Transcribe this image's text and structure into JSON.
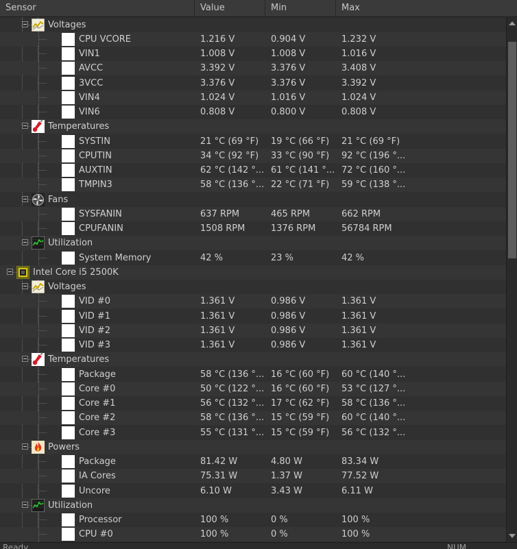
{
  "header": {
    "sensor": "Sensor",
    "value": "Value",
    "min": "Min",
    "max": "Max"
  },
  "rows": [
    {
      "level": 2,
      "kind": "group",
      "icon": "voltage-icon",
      "name": "Voltages"
    },
    {
      "level": 3,
      "kind": "sensor",
      "name": "CPU VCORE",
      "value": "1.216 V",
      "min": "0.904 V",
      "max": "1.232 V"
    },
    {
      "level": 3,
      "kind": "sensor",
      "name": "VIN1",
      "value": "1.008 V",
      "min": "1.008 V",
      "max": "1.016 V"
    },
    {
      "level": 3,
      "kind": "sensor",
      "name": "AVCC",
      "value": "3.392 V",
      "min": "3.376 V",
      "max": "3.408 V"
    },
    {
      "level": 3,
      "kind": "sensor",
      "name": "3VCC",
      "value": "3.376 V",
      "min": "3.376 V",
      "max": "3.392 V"
    },
    {
      "level": 3,
      "kind": "sensor",
      "name": "VIN4",
      "value": "1.024 V",
      "min": "1.016 V",
      "max": "1.024 V"
    },
    {
      "level": 3,
      "kind": "sensor",
      "name": "VIN6",
      "value": "0.808 V",
      "min": "0.800 V",
      "max": "0.808 V"
    },
    {
      "level": 2,
      "kind": "group",
      "icon": "thermometer-icon",
      "name": "Temperatures"
    },
    {
      "level": 3,
      "kind": "sensor",
      "name": "SYSTIN",
      "value": "21 °C  (69 °F)",
      "min": "19 °C  (66 °F)",
      "max": "21 °C  (69 °F)"
    },
    {
      "level": 3,
      "kind": "sensor",
      "name": "CPUTIN",
      "value": "34 °C  (92 °F)",
      "min": "33 °C  (90 °F)",
      "max": "92 °C  (196 °..."
    },
    {
      "level": 3,
      "kind": "sensor",
      "name": "AUXTIN",
      "value": "62 °C  (142 °...",
      "min": "61 °C  (141 °...",
      "max": "72 °C  (160 °..."
    },
    {
      "level": 3,
      "kind": "sensor",
      "name": "TMPIN3",
      "value": "58 °C  (136 °...",
      "min": "22 °C  (71 °F)",
      "max": "59 °C  (138 °..."
    },
    {
      "level": 2,
      "kind": "group",
      "icon": "fan-icon",
      "name": "Fans"
    },
    {
      "level": 3,
      "kind": "sensor",
      "name": "SYSFANIN",
      "value": "637 RPM",
      "min": "465 RPM",
      "max": "662 RPM"
    },
    {
      "level": 3,
      "kind": "sensor",
      "name": "CPUFANIN",
      "value": "1508 RPM",
      "min": "1376 RPM",
      "max": "56784 RPM"
    },
    {
      "level": 2,
      "kind": "group",
      "icon": "utilization-icon",
      "name": "Utilization"
    },
    {
      "level": 3,
      "kind": "sensor",
      "name": "System Memory",
      "value": "42 %",
      "min": "23 %",
      "max": "42 %"
    },
    {
      "level": 1,
      "kind": "hardware",
      "icon": "cpu-chip-icon",
      "name": "Intel Core i5 2500K"
    },
    {
      "level": 2,
      "kind": "group",
      "icon": "voltage-icon",
      "name": "Voltages"
    },
    {
      "level": 3,
      "kind": "sensor",
      "name": "VID #0",
      "value": "1.361 V",
      "min": "0.986 V",
      "max": "1.361 V"
    },
    {
      "level": 3,
      "kind": "sensor",
      "name": "VID #1",
      "value": "1.361 V",
      "min": "0.986 V",
      "max": "1.361 V"
    },
    {
      "level": 3,
      "kind": "sensor",
      "name": "VID #2",
      "value": "1.361 V",
      "min": "0.986 V",
      "max": "1.361 V"
    },
    {
      "level": 3,
      "kind": "sensor",
      "name": "VID #3",
      "value": "1.361 V",
      "min": "0.986 V",
      "max": "1.361 V"
    },
    {
      "level": 2,
      "kind": "group",
      "icon": "thermometer-icon",
      "name": "Temperatures"
    },
    {
      "level": 3,
      "kind": "sensor",
      "name": "Package",
      "value": "58 °C  (136 °...",
      "min": "16 °C  (60 °F)",
      "max": "60 °C  (140 °..."
    },
    {
      "level": 3,
      "kind": "sensor",
      "name": "Core #0",
      "value": "50 °C  (122 °...",
      "min": "16 °C  (60 °F)",
      "max": "53 °C  (127 °..."
    },
    {
      "level": 3,
      "kind": "sensor",
      "name": "Core #1",
      "value": "56 °C  (132 °...",
      "min": "17 °C  (62 °F)",
      "max": "58 °C  (136 °..."
    },
    {
      "level": 3,
      "kind": "sensor",
      "name": "Core #2",
      "value": "58 °C  (136 °...",
      "min": "15 °C  (59 °F)",
      "max": "60 °C  (140 °..."
    },
    {
      "level": 3,
      "kind": "sensor",
      "name": "Core #3",
      "value": "55 °C  (131 °...",
      "min": "15 °C  (59 °F)",
      "max": "56 °C  (132 °..."
    },
    {
      "level": 2,
      "kind": "group",
      "icon": "power-flame-icon",
      "name": "Powers"
    },
    {
      "level": 3,
      "kind": "sensor",
      "name": "Package",
      "value": "81.42 W",
      "min": "4.80 W",
      "max": "83.34 W"
    },
    {
      "level": 3,
      "kind": "sensor",
      "name": "IA Cores",
      "value": "75.31 W",
      "min": "1.37 W",
      "max": "77.52 W"
    },
    {
      "level": 3,
      "kind": "sensor",
      "name": "Uncore",
      "value": "6.10 W",
      "min": "3.43 W",
      "max": "6.11 W"
    },
    {
      "level": 2,
      "kind": "group",
      "icon": "utilization-icon",
      "name": "Utilization"
    },
    {
      "level": 3,
      "kind": "sensor",
      "name": "Processor",
      "value": "100 %",
      "min": "0 %",
      "max": "100 %"
    },
    {
      "level": 3,
      "kind": "sensor",
      "name": "CPU #0",
      "value": "100 %",
      "min": "0 %",
      "max": "100 %"
    }
  ],
  "status": {
    "left": "Ready",
    "right": "NUM"
  }
}
